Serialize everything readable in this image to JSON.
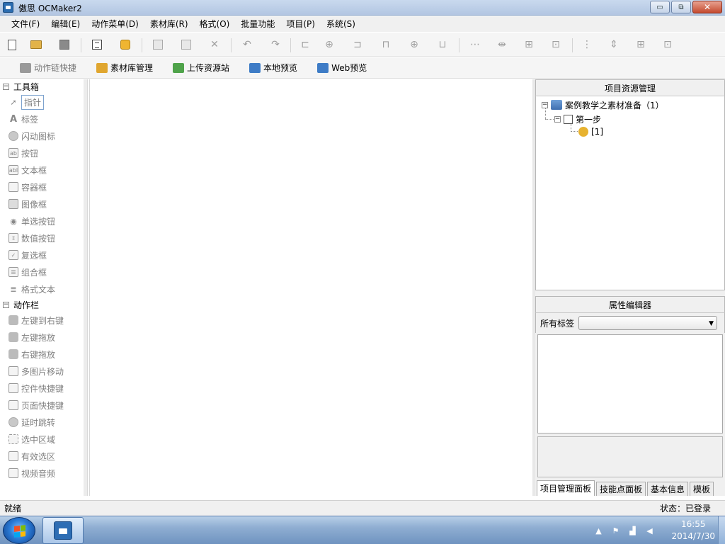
{
  "window": {
    "title": "傲思 OCMaker2",
    "buttons": {
      "minimize": "▭",
      "maximize": "⧉",
      "close": "✕"
    }
  },
  "menu": [
    "文件(F)",
    "编辑(E)",
    "动作菜单(D)",
    "素材库(R)",
    "格式(O)",
    "批量功能",
    "项目(P)",
    "系统(S)"
  ],
  "toolbar2": [
    {
      "label": "动作链快捷",
      "icon": "chain-shortcut-icon",
      "color": "#9a9a9a",
      "disabled": true
    },
    {
      "label": "素材库管理",
      "icon": "library-icon",
      "color": "#e0a62f",
      "disabled": false
    },
    {
      "label": "上传资源站",
      "icon": "upload-icon",
      "color": "#4fa34a",
      "disabled": false
    },
    {
      "label": "本地预览",
      "icon": "monitor-icon",
      "color": "#3e7cc6",
      "disabled": false
    },
    {
      "label": "Web预览",
      "icon": "web-preview-icon",
      "color": "#3e7cc6",
      "disabled": false
    }
  ],
  "toolbox": {
    "header": "工具箱",
    "items": [
      {
        "label": "指针",
        "icon": "pointer-icon",
        "selected": true
      },
      {
        "label": "标签",
        "icon": "label-a-icon"
      },
      {
        "label": "闪动图标",
        "icon": "flash-icon"
      },
      {
        "label": "按钮",
        "icon": "button-ab-icon"
      },
      {
        "label": "文本框",
        "icon": "textbox-icon"
      },
      {
        "label": "容器框",
        "icon": "container-icon"
      },
      {
        "label": "图像框",
        "icon": "image-icon"
      },
      {
        "label": "单选按钮",
        "icon": "radio-icon"
      },
      {
        "label": "数值按钮",
        "icon": "spinner-icon"
      },
      {
        "label": "复选框",
        "icon": "checkbox-icon"
      },
      {
        "label": "组合框",
        "icon": "combobox-icon"
      },
      {
        "label": "格式文本",
        "icon": "richtext-icon"
      }
    ]
  },
  "actionbar": {
    "header": "动作栏",
    "items": [
      {
        "label": "左键到右键",
        "icon": "mouse-icon"
      },
      {
        "label": "左键拖放",
        "icon": "drag-icon"
      },
      {
        "label": "右键拖放",
        "icon": "right-drag-icon"
      },
      {
        "label": "多图片移动",
        "icon": "multi-image-icon"
      },
      {
        "label": "控件快捷键",
        "icon": "control-shortcut-icon"
      },
      {
        "label": "页面快捷键",
        "icon": "page-shortcut-icon"
      },
      {
        "label": "延时跳转",
        "icon": "delay-icon"
      },
      {
        "label": "选中区域",
        "icon": "select-area-icon"
      },
      {
        "label": "有效选区",
        "icon": "valid-area-icon"
      },
      {
        "label": "视频音频",
        "icon": "media-icon"
      }
    ]
  },
  "project": {
    "header": "项目资源管理",
    "root": "案例教学之素材准备（1）",
    "step": "第一步",
    "leaf": "[1]"
  },
  "properties": {
    "header": "属性编辑器",
    "filter_label": "所有标签",
    "filter_value": ""
  },
  "tabs": [
    "项目管理面板",
    "技能点面板",
    "基本信息",
    "模板"
  ],
  "status": {
    "left": "就绪",
    "right": "状态：已登录"
  },
  "taskbar": {
    "time": "16:55",
    "date": "2014/7/30"
  }
}
